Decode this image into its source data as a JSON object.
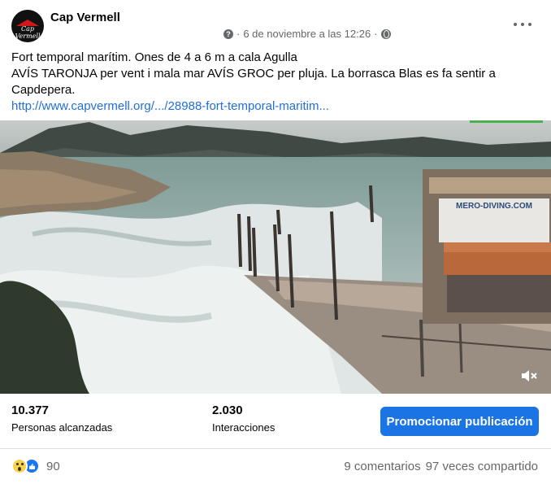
{
  "post": {
    "page_name": "Cap Vermell",
    "avatar_text": "Cap Vermell",
    "date": "6 de noviembre a las 12:26",
    "separator": "·",
    "text_line1": "Fort temporal marítim. Ones de 4 a 6 m a cala Agulla",
    "text_line2": "AVÍS TARONJA per vent i mala mar AVÍS GROC per pluja. La borrasca Blas es fa sentir a Capdepera.",
    "link": "http://www.capvermell.org/.../28988-fort-temporal-maritim..."
  },
  "media": {
    "sign_title": "MERO-DIVING.COM"
  },
  "stats": {
    "reach_value": "10.377",
    "reach_label": "Personas alcanzadas",
    "interactions_value": "2.030",
    "interactions_label": "Interacciones",
    "promote_label": "Promocionar publicación"
  },
  "footer": {
    "reaction_count": "90",
    "comments": "9 comentarios",
    "shares": "97 veces compartido"
  },
  "icons": [
    "privacy-icon",
    "globe-icon",
    "more-options-icon",
    "wow-reaction-icon",
    "like-reaction-icon",
    "mute-icon"
  ],
  "colors": {
    "accent": "#1b74e4",
    "link": "#216fdb",
    "secondary_text": "#65676b"
  }
}
